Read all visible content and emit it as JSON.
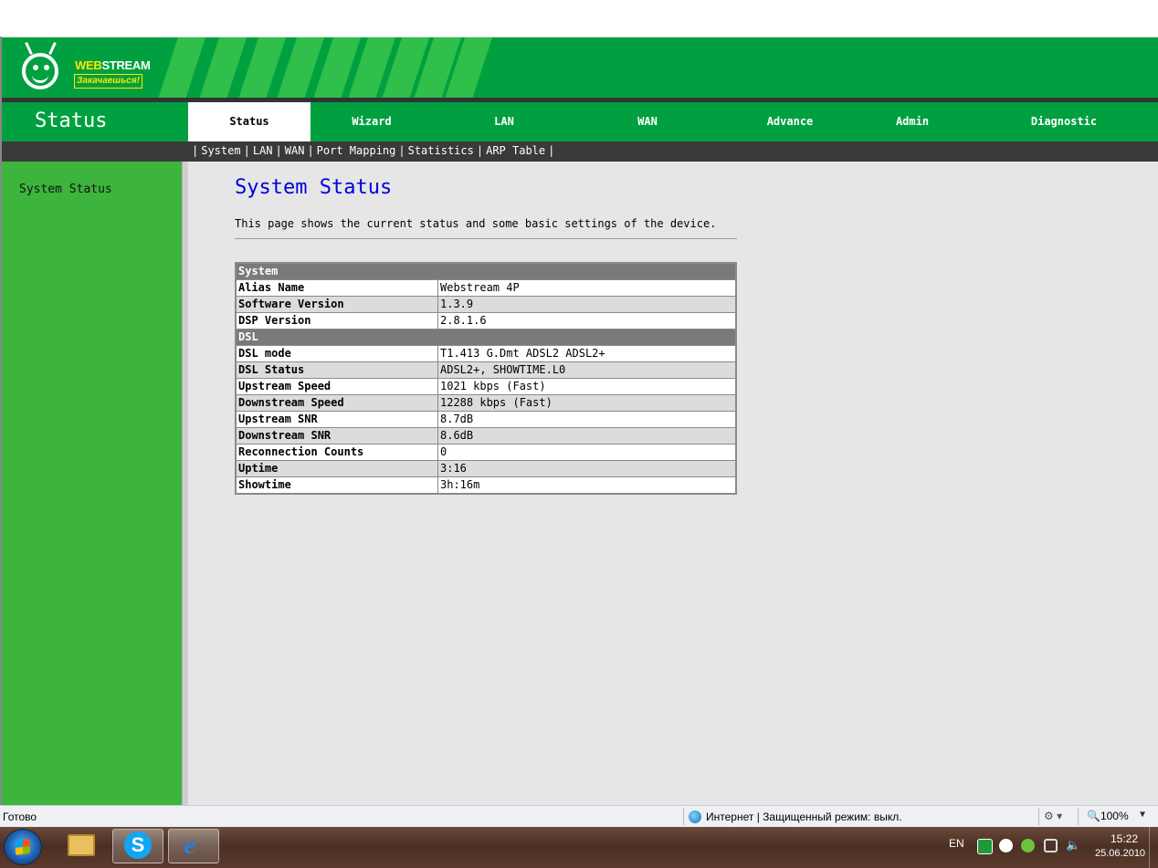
{
  "banner": {
    "logo_text_web": "WEB",
    "logo_text_stream": "STREAM",
    "logo_slogan": "Закачаешься!"
  },
  "header": {
    "section_title": "Status"
  },
  "nav": {
    "tabs": [
      {
        "label": "Status",
        "active": true
      },
      {
        "label": "Wizard"
      },
      {
        "label": "LAN"
      },
      {
        "label": "WAN"
      },
      {
        "label": "Advance"
      },
      {
        "label": "Admin"
      },
      {
        "label": "Diagnostic"
      }
    ],
    "subnav": [
      "System",
      "LAN",
      "WAN",
      "Port Mapping",
      "Statistics",
      "ARP Table"
    ]
  },
  "sidebar": {
    "items": [
      {
        "label": "System Status"
      }
    ]
  },
  "main": {
    "title": "System Status",
    "description": "This page shows the current status and some basic settings of the device.",
    "sections": [
      {
        "heading": "System",
        "rows": [
          {
            "label": "Alias Name",
            "value": "Webstream 4P"
          },
          {
            "label": "Software Version",
            "value": "1.3.9"
          },
          {
            "label": "DSP Version",
            "value": "2.8.1.6"
          }
        ]
      },
      {
        "heading": "DSL",
        "rows": [
          {
            "label": "DSL mode",
            "value": "T1.413 G.Dmt ADSL2 ADSL2+"
          },
          {
            "label": "DSL Status",
            "value": "ADSL2+, SHOWTIME.L0"
          },
          {
            "label": "Upstream Speed",
            "value": "1021 kbps  (Fast)"
          },
          {
            "label": "Downstream Speed",
            "value": "12288 kbps  (Fast)"
          },
          {
            "label": "Upstream SNR",
            "value": "8.7dB"
          },
          {
            "label": "Downstream SNR",
            "value": "8.6dB"
          },
          {
            "label": "Reconnection Counts",
            "value": "0"
          },
          {
            "label": "Uptime",
            "value": "3:16"
          },
          {
            "label": "Showtime",
            "value": "3h:16m"
          }
        ]
      }
    ]
  },
  "statusbar": {
    "ready": "Готово",
    "zone": "Интернет | Защищенный режим: выкл.",
    "zoom": "100%"
  },
  "taskbar": {
    "lang": "EN",
    "time": "15:22",
    "date": "25.06.2010"
  },
  "colors": {
    "brand_green": "#00a040",
    "sidebar_green": "#3db53d",
    "title_blue": "#0000e0",
    "table_header_gray": "#7a7a7a"
  }
}
